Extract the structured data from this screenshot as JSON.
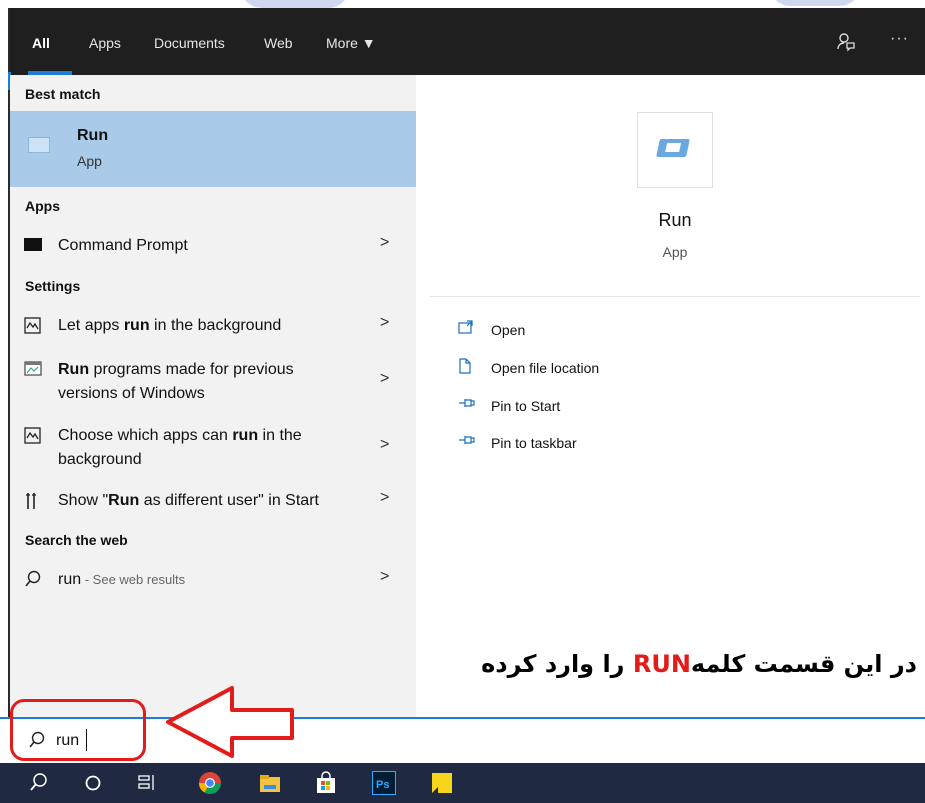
{
  "header": {
    "tabs": [
      {
        "label": "All",
        "active": true
      },
      {
        "label": "Apps"
      },
      {
        "label": "Documents"
      },
      {
        "label": "Web"
      },
      {
        "label": "More ▼"
      }
    ],
    "feedback_icon": "feedback-icon",
    "more_options": "···"
  },
  "left": {
    "best_match_header": "Best match",
    "best_match": {
      "title": "Run",
      "subtitle": "App"
    },
    "apps_header": "Apps",
    "apps": [
      {
        "label": "Command Prompt",
        "icon": "command-prompt-icon"
      }
    ],
    "settings_header": "Settings",
    "settings": [
      {
        "pre": "Let apps ",
        "bold": "run",
        "post": " in the background",
        "icon": "background-apps-icon"
      },
      {
        "pre": "",
        "bold": "Run",
        "post": " programs made for previous",
        "line2": "versions of Windows",
        "icon": "compatibility-icon"
      },
      {
        "pre": "Choose which apps can ",
        "bold": "run",
        "post": " in the",
        "line2": "background",
        "icon": "background-apps-icon"
      },
      {
        "pre": "Show \"",
        "bold": "Run",
        "post": " as different user\" in Start",
        "icon": "start-settings-icon"
      }
    ],
    "web_header": "Search the web",
    "web": {
      "query": "run",
      "suffix": " - See web results"
    },
    "chevron": ">"
  },
  "right": {
    "app_title": "Run",
    "app_sub": "App",
    "actions": [
      "Open",
      "Open file location",
      "Pin to Start",
      "Pin to taskbar"
    ]
  },
  "annotation": {
    "before": "در این قسمت کلمه",
    "highlight": "RUN",
    "after": "را وارد کرده"
  },
  "search": {
    "value": "run"
  },
  "colors": {
    "accent": "#1a7fd4",
    "selection": "#a9cbe9",
    "annotation_red": "#e41b1b",
    "taskbar": "#202942"
  }
}
